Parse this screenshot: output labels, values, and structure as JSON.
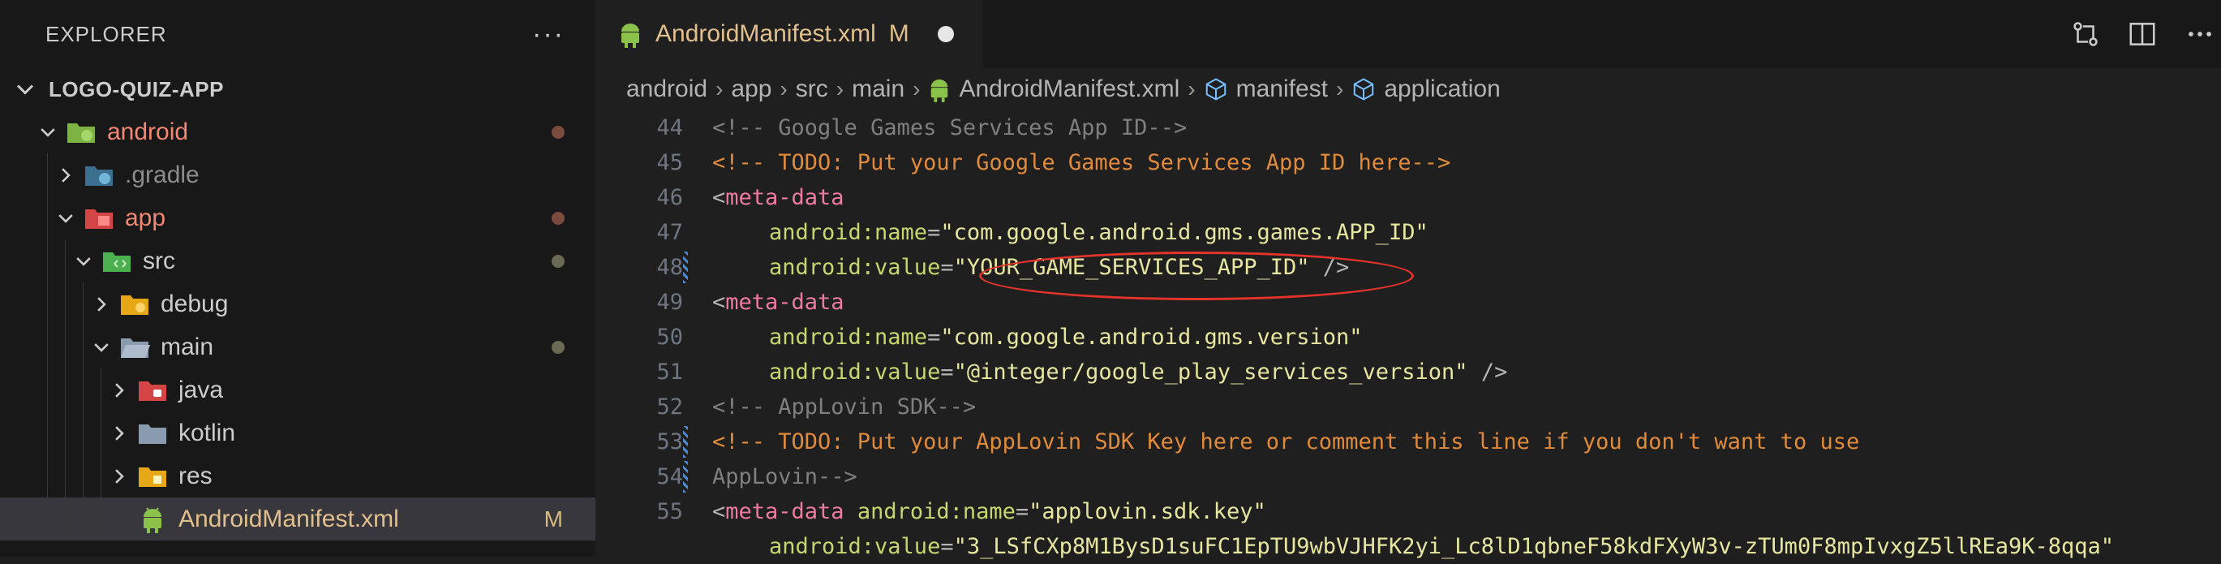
{
  "sidebar": {
    "title": "EXPLORER",
    "more_label": "···",
    "project": "LOGO-QUIZ-APP",
    "tree": [
      {
        "label": "android",
        "color": "#f48771"
      },
      {
        "label": ".gradle",
        "color": "#8c8c8c"
      },
      {
        "label": "app",
        "color": "#f48771"
      },
      {
        "label": "src",
        "color": "#cccccc"
      },
      {
        "label": "debug",
        "color": "#cccccc"
      },
      {
        "label": "main",
        "color": "#cccccc"
      },
      {
        "label": "java",
        "color": "#cccccc"
      },
      {
        "label": "kotlin",
        "color": "#cccccc"
      },
      {
        "label": "res",
        "color": "#cccccc"
      },
      {
        "label": "AndroidManifest.xml",
        "color": "#e2c08d",
        "badge": "M"
      }
    ]
  },
  "editor": {
    "tab": {
      "label": "AndroidManifest.xml",
      "badge": "M"
    },
    "breadcrumb": [
      "android",
      "app",
      "src",
      "main",
      "AndroidManifest.xml",
      "manifest",
      "application"
    ],
    "lines": [
      {
        "n": "44",
        "parts": [
          "<!-- Google Games Services App ID-->"
        ]
      },
      {
        "n": "45",
        "parts": [
          "<!-- TODO: Put your Google Games Services App ID here-->"
        ]
      },
      {
        "n": "46",
        "parts": [
          "<",
          "meta-data"
        ]
      },
      {
        "n": "47",
        "parts": [
          "android:name",
          "=",
          "\"com.google.android.gms.games.APP_ID\""
        ]
      },
      {
        "n": "48",
        "parts": [
          "android:value",
          "=",
          "\"YOUR_GAME_SERVICES_APP_ID\"",
          " />"
        ]
      },
      {
        "n": "49",
        "parts": [
          "<",
          "meta-data"
        ]
      },
      {
        "n": "50",
        "parts": [
          "android:name",
          "=",
          "\"com.google.android.gms.version\""
        ]
      },
      {
        "n": "51",
        "parts": [
          "android:value",
          "=",
          "\"@integer/google_play_services_version\"",
          " />"
        ]
      },
      {
        "n": "52",
        "parts": [
          "<!-- AppLovin SDK-->"
        ]
      },
      {
        "n": "53",
        "parts": [
          "<!-- TODO: Put your AppLovin SDK Key here or comment this line if you don't want to use"
        ]
      },
      {
        "n": "54",
        "parts": [
          "AppLovin-->"
        ]
      },
      {
        "n": "55",
        "parts": [
          "<",
          "meta-data",
          " android:name",
          "=",
          "\"applovin.sdk.key\""
        ]
      },
      {
        "n": "",
        "parts": [
          "android:value",
          "=",
          "\"3_LSfCXp8M1BysD1suFC1EpTU9wbVJHFK2yi_Lc8lD1qbneF58kdFXyW3v-zTUm0F8mpIvxgZ5llREa9K-8qqa\""
        ]
      }
    ]
  },
  "colors": {
    "accent_orange": "#e08a3c",
    "modified": "#e2c08d",
    "highlight_oval": "#e3332b"
  }
}
